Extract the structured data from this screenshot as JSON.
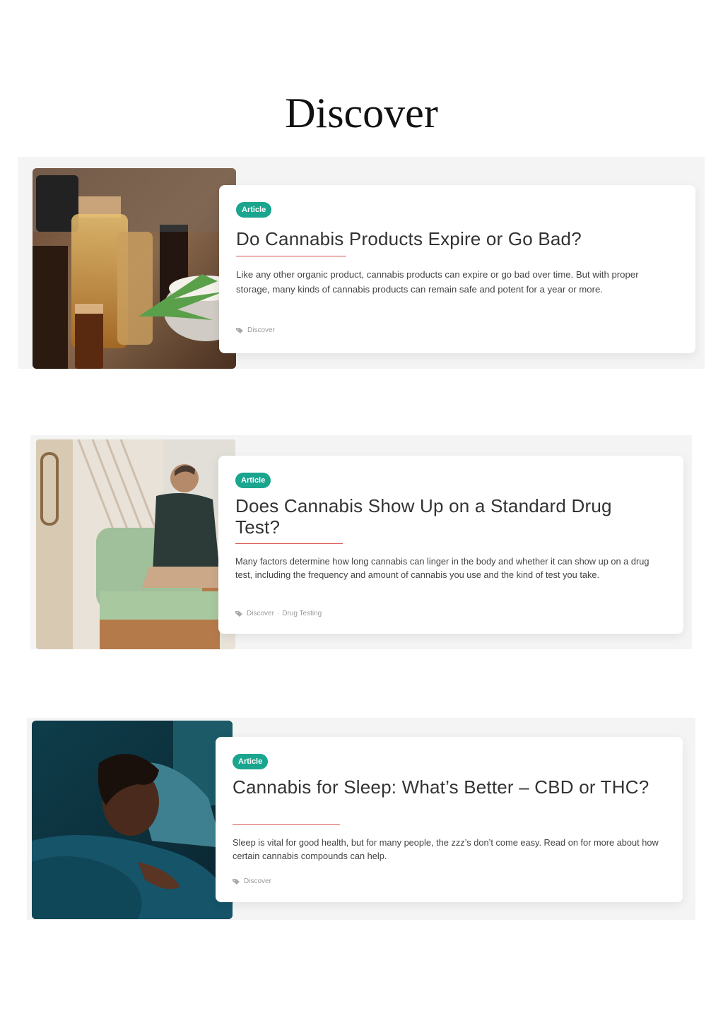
{
  "page": {
    "title": "Discover"
  },
  "articles": [
    {
      "badge": "Article",
      "title": "Do Cannabis Products Expire or Go Bad?",
      "excerpt": "Like any other organic product, cannabis products can expire or go bad over time. But with proper storage, many kinds of cannabis products can remain safe and potent for a year or more.",
      "tags": [
        "Discover"
      ],
      "image": "cannabis-products-bottles-photo"
    },
    {
      "badge": "Article",
      "title": "Does Cannabis Show Up on a Standard Drug Test?",
      "excerpt": "Many factors determine how long cannabis can linger in the body and whether it can show up on a drug test, including the frequency and amount of cannabis you use and the kind of test you take.",
      "tags": [
        "Discover",
        "Drug Testing"
      ],
      "tag_separator": "·",
      "image": "man-sitting-on-couch-photo"
    },
    {
      "badge": "Article",
      "title": "Cannabis for Sleep: What’s Better – CBD or THC?",
      "excerpt": "Sleep is vital for good health, but for many people, the zzz’s don’t come easy. Read on for more about how certain cannabis compounds can help.",
      "tags": [
        "Discover"
      ],
      "image": "woman-sleeping-photo"
    }
  ],
  "colors": {
    "badge": "#1aa58e",
    "accent_rule": "#d9534f",
    "band": "#f4f4f4"
  }
}
